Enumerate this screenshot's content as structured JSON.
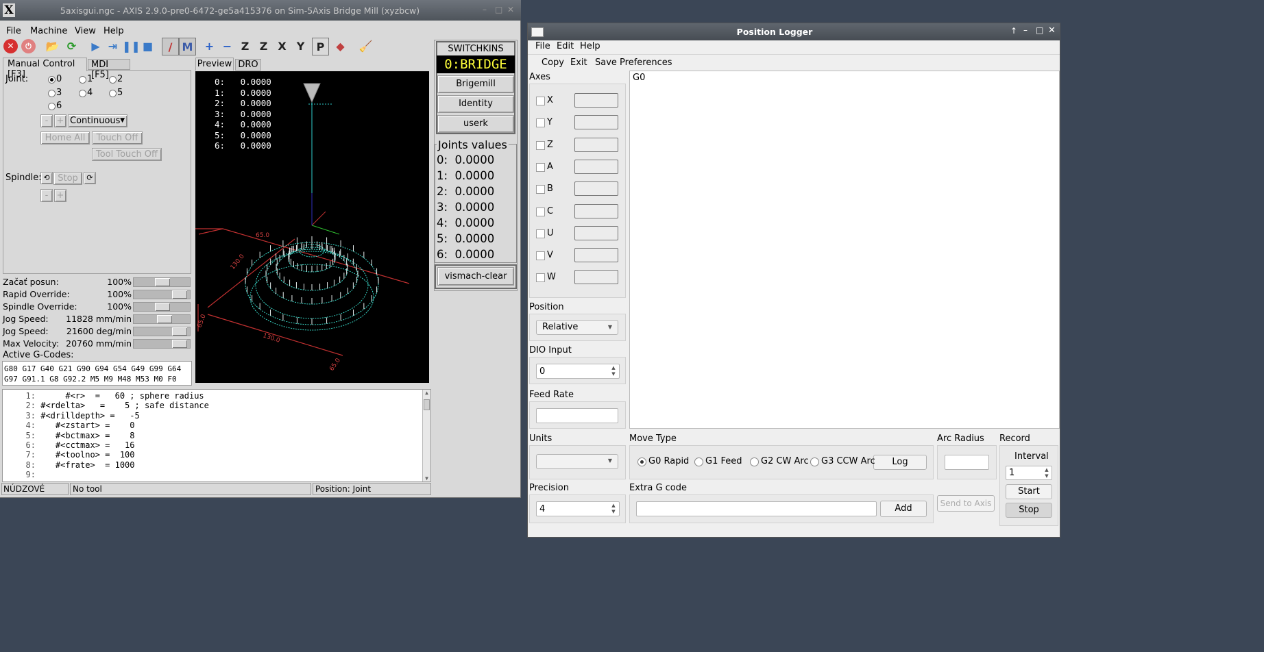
{
  "desktop": {
    "bg": "#3b4656"
  },
  "axis": {
    "title": "5axisgui.ngc - AXIS 2.9.0-pre0-6472-ge5a415376 on Sim-5Axis Bridge Mill (xyzbcw)",
    "logo": "X",
    "winctl": [
      "–",
      "□",
      "✕"
    ],
    "menu": [
      "File",
      "Machine",
      "View",
      "Help"
    ],
    "toolbar": [
      "estop-icon",
      "power-icon",
      "open-icon",
      "reload-icon",
      "run-icon",
      "step-icon",
      "pause-icon",
      "stop-icon",
      "block-delete-icon",
      "optional-stop-icon",
      "zoom-in-icon",
      "zoom-out-icon",
      "view-z-icon",
      "view-z2-icon",
      "view-x-icon",
      "view-y-icon",
      "view-p-icon",
      "rotate-icon",
      "clear-live-plot-icon"
    ],
    "tab_manual": "Manual Control [F3]",
    "tab_mdi": "MDI [F5]",
    "joint_label": "Joint:",
    "joints": [
      "0",
      "1",
      "2",
      "3",
      "4",
      "5",
      "6"
    ],
    "jog_minus": "-",
    "jog_plus": "+",
    "jog_mode": "Continuous",
    "home_all": "Home All",
    "touch_off": "Touch Off",
    "tool_touch_off": "Tool Touch Off",
    "spindle_label": "Spindle:",
    "spindle_stop": "Stop",
    "sliders": [
      {
        "label": "Začať posun:",
        "value": "100",
        "unit": "%",
        "level": 0.5
      },
      {
        "label": "Rapid Override:",
        "value": "100",
        "unit": "%",
        "level": 0.9
      },
      {
        "label": "Spindle Override:",
        "value": "100",
        "unit": "%",
        "level": 0.5
      },
      {
        "label": "Jog Speed:",
        "value": "11828 mm/min",
        "unit": "",
        "level": 0.55
      },
      {
        "label": "Jog Speed:",
        "value": "21600 deg/min",
        "unit": "",
        "level": 0.9
      },
      {
        "label": "Max Velocity:",
        "value": "20760 mm/min",
        "unit": "",
        "level": 0.9
      }
    ],
    "gcodes_label": "Active G-Codes:",
    "gcodes_line1": "G80 G17 G40 G21 G90 G94 G54 G49 G99 G64",
    "gcodes_line2": "G97 G91.1 G8 G92.2 M5 M9 M48 M53 M0 F0",
    "tab_preview": "Preview",
    "tab_dro": "DRO",
    "dro": [
      {
        "n": "0:",
        "v": "0.0000"
      },
      {
        "n": "1:",
        "v": "0.0000"
      },
      {
        "n": "2:",
        "v": "0.0000"
      },
      {
        "n": "3:",
        "v": "0.0000"
      },
      {
        "n": "4:",
        "v": "0.0000"
      },
      {
        "n": "5:",
        "v": "0.0000"
      },
      {
        "n": "6:",
        "v": "0.0000"
      }
    ],
    "plot_labels": [
      "65.0",
      "130.0",
      "130.0",
      "65.0",
      "65.0"
    ],
    "vcp_title": "SWITCHKINS",
    "vcp_kins": "0:BRIDGE",
    "vcp_buttons": [
      "Brigemill",
      "Identity",
      "userk"
    ],
    "joints_values_title": "Joints values",
    "joints_values": [
      {
        "n": "0:",
        "v": "0.0000"
      },
      {
        "n": "1:",
        "v": "0.0000"
      },
      {
        "n": "2:",
        "v": "0.0000"
      },
      {
        "n": "3:",
        "v": "0.0000"
      },
      {
        "n": "4:",
        "v": "0.0000"
      },
      {
        "n": "5:",
        "v": "0.0000"
      },
      {
        "n": "6:",
        "v": "0.0000"
      }
    ],
    "vismach_clear": "vismach-clear",
    "code_lines": [
      {
        "n": "1:",
        "t": "     #<r>  =   60 ; sphere radius"
      },
      {
        "n": "2:",
        "t": "#<rdelta>   =    5 ; safe distance"
      },
      {
        "n": "3:",
        "t": "#<drilldepth> =   -5"
      },
      {
        "n": "4:",
        "t": "   #<zstart> =    0"
      },
      {
        "n": "5:",
        "t": "   #<bctmax> =    8"
      },
      {
        "n": "6:",
        "t": "   #<cctmax> =   16"
      },
      {
        "n": "7:",
        "t": "   #<toolno> =  100"
      },
      {
        "n": "8:",
        "t": "   #<frate>  = 1000"
      },
      {
        "n": "9:",
        "t": ""
      }
    ],
    "status_estop": "NÚDZOVÉ PRERU",
    "status_tool": "No tool",
    "status_pos": "Position: Joint"
  },
  "logger": {
    "title": "Position Logger",
    "winctl": [
      "↑",
      "–",
      "□",
      "✕"
    ],
    "menu": [
      "File",
      "Edit",
      "Help"
    ],
    "toolbar": [
      "Copy",
      "Exit",
      "Save Preferences"
    ],
    "axes_label": "Axes",
    "axes": [
      "X",
      "Y",
      "Z",
      "A",
      "B",
      "C",
      "U",
      "V",
      "W"
    ],
    "log_text": "G0",
    "position_label": "Position",
    "position_value": "Relative",
    "dio_label": "DIO  Input",
    "dio_value": "0",
    "feed_label": "Feed Rate",
    "units_label": "Units",
    "move_type_label": "Move Type",
    "moves": [
      "G0 Rapid",
      "G1 Feed",
      "G2 CW Arc",
      "G3 CCW Arc"
    ],
    "log_button": "Log",
    "arc_label": "Arc Radius",
    "record_label": "Record",
    "interval_label": "Interval",
    "interval_value": "1",
    "start_button": "Start",
    "stop_button": "Stop",
    "precision_label": "Precision",
    "precision_value": "4",
    "extra_label": "Extra G code",
    "add_button": "Add",
    "send_button": "Send to Axis"
  }
}
